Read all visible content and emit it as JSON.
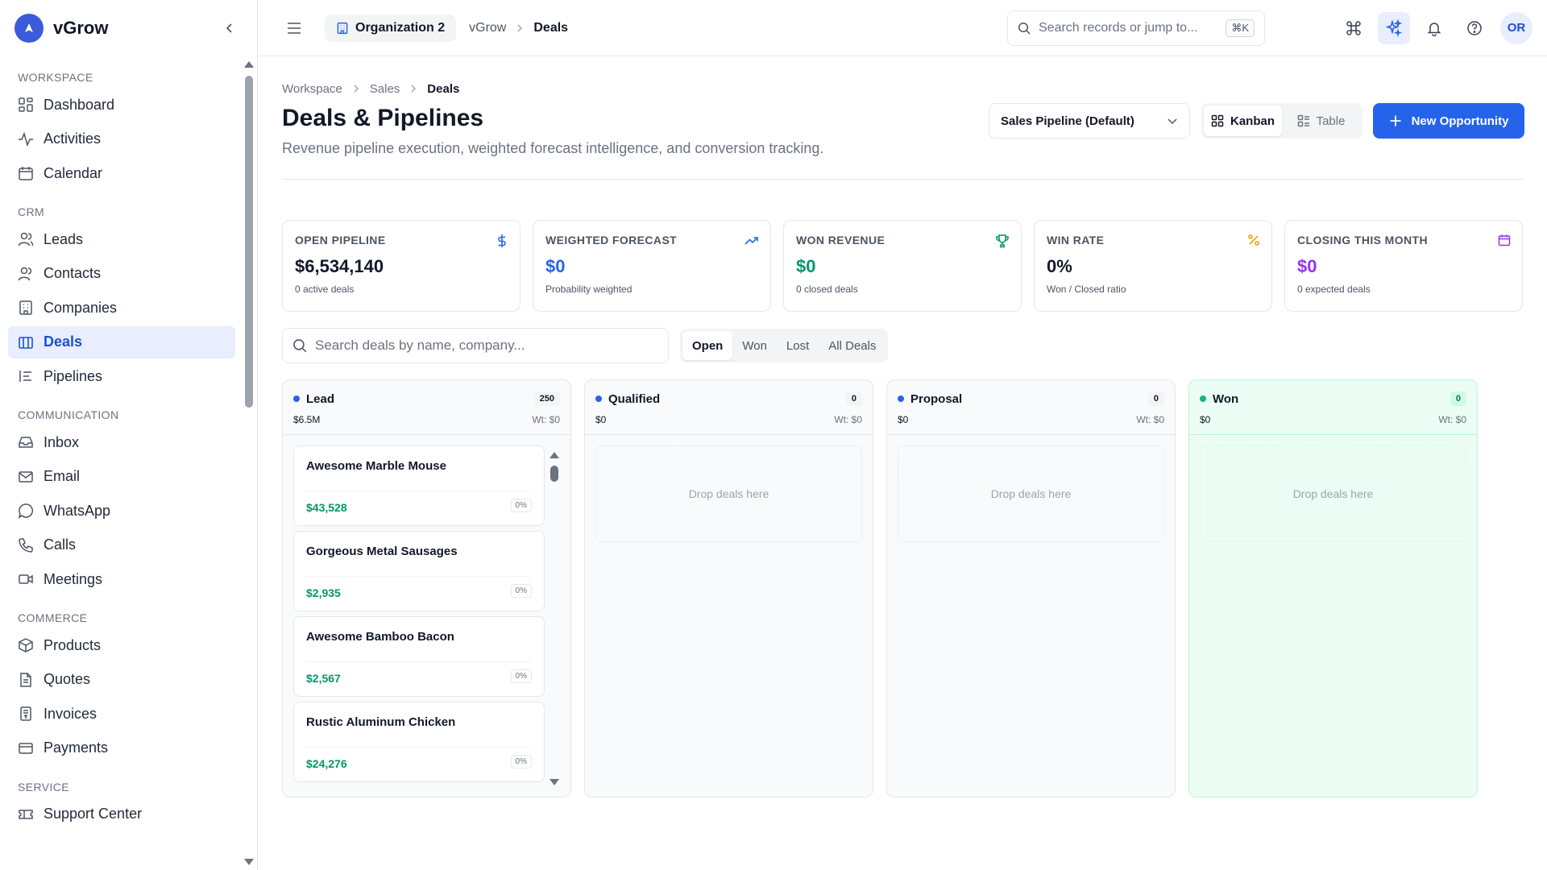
{
  "app": {
    "name": "vGrow"
  },
  "sidebar": {
    "sections": [
      {
        "label": "WORKSPACE",
        "items": [
          {
            "label": "Dashboard",
            "icon": "dashboard-icon"
          },
          {
            "label": "Activities",
            "icon": "activity-icon"
          },
          {
            "label": "Calendar",
            "icon": "calendar-icon"
          }
        ]
      },
      {
        "label": "CRM",
        "items": [
          {
            "label": "Leads",
            "icon": "users-icon"
          },
          {
            "label": "Contacts",
            "icon": "contacts-icon"
          },
          {
            "label": "Companies",
            "icon": "building-icon"
          },
          {
            "label": "Deals",
            "icon": "deals-icon",
            "active": true
          },
          {
            "label": "Pipelines",
            "icon": "pipeline-icon"
          }
        ]
      },
      {
        "label": "COMMUNICATION",
        "items": [
          {
            "label": "Inbox",
            "icon": "inbox-icon"
          },
          {
            "label": "Email",
            "icon": "mail-icon"
          },
          {
            "label": "WhatsApp",
            "icon": "chat-icon"
          },
          {
            "label": "Calls",
            "icon": "phone-icon"
          },
          {
            "label": "Meetings",
            "icon": "video-icon"
          }
        ]
      },
      {
        "label": "COMMERCE",
        "items": [
          {
            "label": "Products",
            "icon": "package-icon"
          },
          {
            "label": "Quotes",
            "icon": "document-icon"
          },
          {
            "label": "Invoices",
            "icon": "receipt-icon"
          },
          {
            "label": "Payments",
            "icon": "credit-card-icon"
          }
        ]
      },
      {
        "label": "SERVICE",
        "items": [
          {
            "label": "Support Center",
            "icon": "ticket-icon"
          }
        ]
      }
    ]
  },
  "topbar": {
    "org": "Organization 2",
    "crumbs": [
      "vGrow",
      "Deals"
    ],
    "search_placeholder": "Search records or jump to...",
    "shortcut": "⌘K",
    "avatar_initials": "OR"
  },
  "page": {
    "breadcrumb": [
      "Workspace",
      "Sales",
      "Deals"
    ],
    "title": "Deals & Pipelines",
    "subtitle": "Revenue pipeline execution, weighted forecast intelligence, and conversion tracking.",
    "pipeline_select": "Sales Pipeline (Default)",
    "views": [
      "Kanban",
      "Table"
    ],
    "new_button": "New Opportunity"
  },
  "stats": [
    {
      "label": "OPEN PIPELINE",
      "value": "$6,534,140",
      "foot": "0 active deals",
      "color": "#111827",
      "icon_color": "#2563eb",
      "icon": "dollar-icon"
    },
    {
      "label": "WEIGHTED FORECAST",
      "value": "$0",
      "foot": "Probability weighted",
      "color": "#2563eb",
      "icon_color": "#2563eb",
      "icon": "trending-up-icon"
    },
    {
      "label": "WON REVENUE",
      "value": "$0",
      "foot": "0 closed deals",
      "color": "#059669",
      "icon_color": "#059669",
      "icon": "trophy-icon"
    },
    {
      "label": "WIN RATE",
      "value": "0%",
      "foot": "Won / Closed ratio",
      "color": "#111827",
      "icon_color": "#f59e0b",
      "icon": "percent-icon"
    },
    {
      "label": "CLOSING THIS MONTH",
      "value": "$0",
      "foot": "0 expected deals",
      "color": "#9333ea",
      "icon_color": "#9333ea",
      "icon": "calendar-icon"
    }
  ],
  "filters": {
    "search_placeholder": "Search deals by name, company...",
    "tabs": [
      "Open",
      "Won",
      "Lost",
      "All Deals"
    ]
  },
  "columns": [
    {
      "name": "Lead",
      "count": "250",
      "total": "$6.5M",
      "weighted": "Wt: $0",
      "dot": "#2563eb",
      "deals": [
        {
          "name": "Awesome Marble Mouse",
          "amount": "$43,528",
          "prob": "0%"
        },
        {
          "name": "Gorgeous Metal Sausages",
          "amount": "$2,935",
          "prob": "0%"
        },
        {
          "name": "Awesome Bamboo Bacon",
          "amount": "$2,567",
          "prob": "0%"
        },
        {
          "name": "Rustic Aluminum Chicken",
          "amount": "$24,276",
          "prob": "0%"
        }
      ]
    },
    {
      "name": "Qualified",
      "count": "0",
      "total": "$0",
      "weighted": "Wt: $0",
      "dot": "#2563eb",
      "empty_text": "Drop deals here"
    },
    {
      "name": "Proposal",
      "count": "0",
      "total": "$0",
      "weighted": "Wt: $0",
      "dot": "#2563eb",
      "empty_text": "Drop deals here"
    },
    {
      "name": "Won",
      "count": "0",
      "total": "$0",
      "weighted": "Wt: $0",
      "dot": "#10b981",
      "empty_text": "Drop deals here"
    }
  ]
}
